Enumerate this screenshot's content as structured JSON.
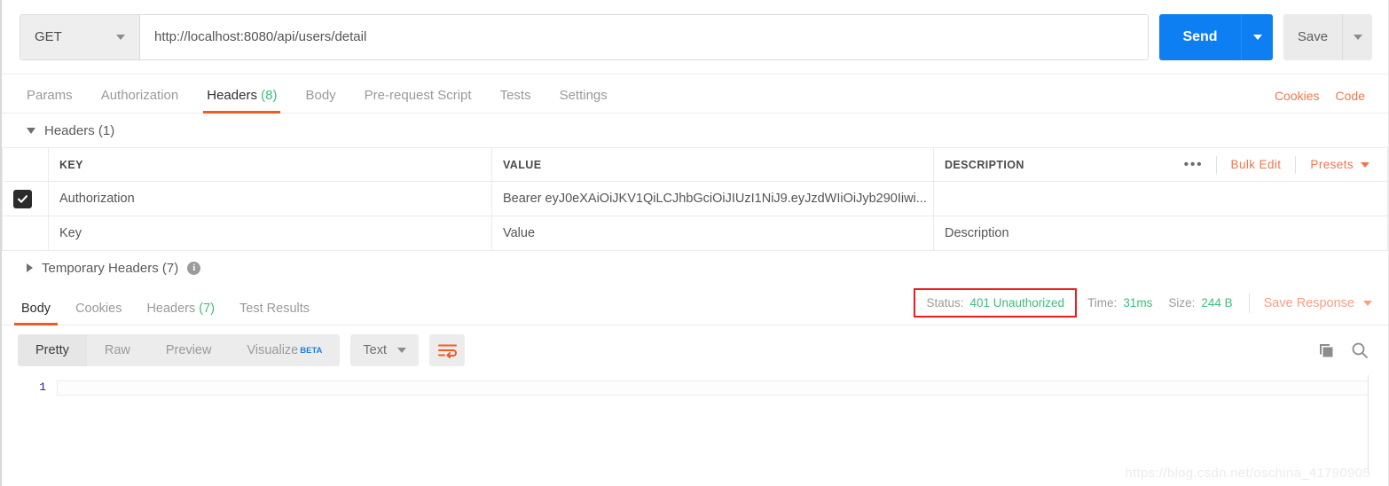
{
  "request": {
    "method": "GET",
    "url": "http://localhost:8080/api/users/detail",
    "send_label": "Send",
    "save_label": "Save"
  },
  "request_tabs": [
    {
      "label": "Params",
      "count": "",
      "active": false
    },
    {
      "label": "Authorization",
      "count": "",
      "active": false
    },
    {
      "label": "Headers",
      "count": "(8)",
      "active": true
    },
    {
      "label": "Body",
      "count": "",
      "active": false
    },
    {
      "label": "Pre-request Script",
      "count": "",
      "active": false
    },
    {
      "label": "Tests",
      "count": "",
      "active": false
    },
    {
      "label": "Settings",
      "count": "",
      "active": false
    }
  ],
  "request_tabs_right": {
    "cookies": "Cookies",
    "code": "Code"
  },
  "headers_section": {
    "title": "Headers (1)",
    "columns": {
      "key": "KEY",
      "value": "VALUE",
      "description": "DESCRIPTION"
    },
    "actions": {
      "more": "•••",
      "bulk_edit": "Bulk Edit",
      "presets": "Presets"
    },
    "rows": [
      {
        "checked": true,
        "key": "Authorization",
        "value": "Bearer eyJ0eXAiOiJKV1QiLCJhbGciOiJIUzI1NiJ9.eyJzdWIiOiJyb290Iiwi...",
        "description": ""
      }
    ],
    "placeholder_row": {
      "key": "Key",
      "value": "Value",
      "description": "Description"
    },
    "temporary_headers": "Temporary Headers (7)"
  },
  "response_tabs": [
    {
      "label": "Body",
      "count": "",
      "active": true
    },
    {
      "label": "Cookies",
      "count": "",
      "active": false
    },
    {
      "label": "Headers",
      "count": "(7)",
      "active": false
    },
    {
      "label": "Test Results",
      "count": "",
      "active": false
    }
  ],
  "response_meta": {
    "status_label": "Status:",
    "status_value": "401 Unauthorized",
    "time_label": "Time:",
    "time_value": "31ms",
    "size_label": "Size:",
    "size_value": "244 B",
    "save_response": "Save Response"
  },
  "view_modes": [
    {
      "label": "Pretty",
      "active": true
    },
    {
      "label": "Raw",
      "active": false
    },
    {
      "label": "Preview",
      "active": false
    },
    {
      "label": "Visualize",
      "active": false,
      "badge": "BETA"
    }
  ],
  "format": {
    "label": "Text"
  },
  "body": {
    "line_numbers": [
      "1"
    ],
    "lines": [
      ""
    ]
  },
  "watermark": "https://blog.csdn.net/oschina_41790905",
  "colors": {
    "accent_orange": "#ef5b25",
    "send_blue": "#0d7ff3",
    "status_green": "#3dbd7d",
    "highlight_red": "#f01c1c"
  }
}
